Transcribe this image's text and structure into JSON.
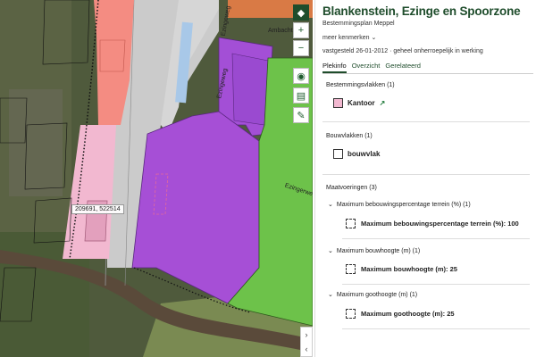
{
  "app": {
    "title": "Blankenstein, Ezinge en Spoorzone",
    "subtitle": "Bestemmingsplan  Meppel",
    "more": "meer kenmerken",
    "status": "vastgesteld 26-01-2012 · geheel onherroepelijk in werking"
  },
  "tabs": [
    "Plekinfo",
    "Overzicht",
    "Gerelateerd"
  ],
  "map": {
    "coordinate": "209691, 522514",
    "street_labels": [
      "Ezingeweg",
      "Ezingeweg",
      "Ambacht",
      "Ezingerweg"
    ],
    "buttons": [
      "layers-icon",
      "zoom-in-icon",
      "zoom-out-icon",
      "locate-icon",
      "measure-icon",
      "draw-icon"
    ]
  },
  "sections": {
    "bestemmingsvlakken": {
      "header": "Bestemmingsvlakken (1)",
      "item": "Kantoor",
      "swatch": "#f0b7d0"
    },
    "bouwvlakken": {
      "header": "Bouwvlakken (1)",
      "item": "bouwvlak"
    },
    "maatvoeringen": {
      "header": "Maatvoeringen (3)",
      "groups": [
        {
          "label": "Maximum bebouwingspercentage terrein (%) (1)",
          "value": "Maximum bebouwingspercentage terrein (%): 100"
        },
        {
          "label": "Maximum bouwhoogte (m) (1)",
          "value": "Maximum bouwhoogte (m): 25"
        },
        {
          "label": "Maximum goothoogte (m) (1)",
          "value": "Maximum goothoogte (m): 25"
        }
      ]
    }
  },
  "colors": {
    "brand": "#1f4d2c",
    "purple": "#a64fd6",
    "green": "#6dc24a",
    "pink": "#f0b7d0",
    "salmon": "#f48c82",
    "grey": "#c9c9c9"
  }
}
